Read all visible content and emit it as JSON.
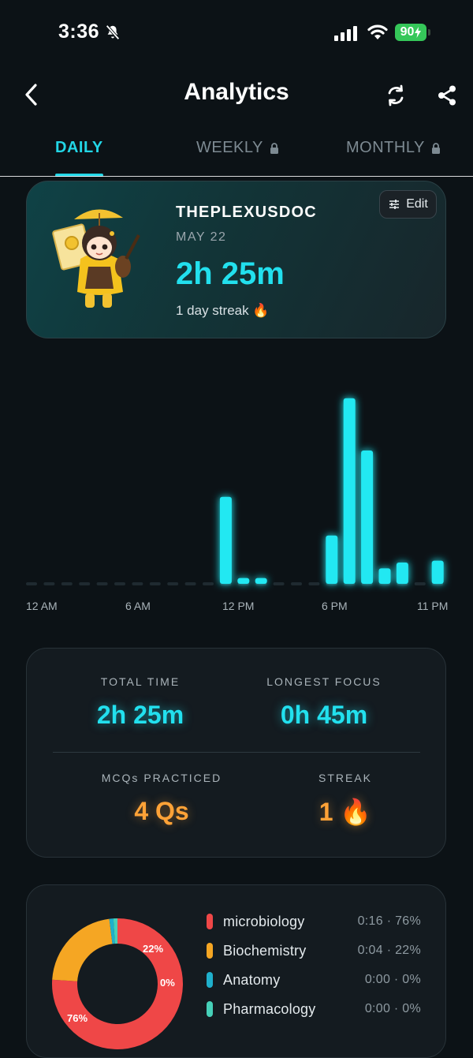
{
  "status_bar": {
    "time": "3:36",
    "battery": "90"
  },
  "header": {
    "title": "Analytics"
  },
  "tabs": [
    {
      "label": "DAILY",
      "active": true,
      "locked": false
    },
    {
      "label": "WEEKLY",
      "active": false,
      "locked": true
    },
    {
      "label": "MONTHLY",
      "active": false,
      "locked": true
    }
  ],
  "profile": {
    "name": "THEPLEXUSDOC",
    "date": "MAY 22",
    "total_time": "2h 25m",
    "streak_text": "1 day streak 🔥",
    "edit_label": "Edit"
  },
  "chart_data": {
    "type": "bar",
    "x_tick_labels": [
      "12 AM",
      "6 AM",
      "12 PM",
      "6 PM",
      "11 PM"
    ],
    "categories": [
      "0",
      "1",
      "2",
      "3",
      "4",
      "5",
      "6",
      "7",
      "8",
      "9",
      "10",
      "11",
      "12",
      "13",
      "14",
      "15",
      "16",
      "17",
      "18",
      "19",
      "20",
      "21",
      "22",
      "23"
    ],
    "values": [
      0,
      0,
      0,
      0,
      0,
      0,
      0,
      0,
      0,
      0,
      0,
      45,
      3,
      3,
      0,
      0,
      0,
      25,
      96,
      69,
      8,
      11,
      0,
      12
    ],
    "value_unit": "relative",
    "ylim": [
      0,
      100
    ],
    "colors": {
      "bar": "#22e8f2",
      "baseline": "#1f2a30"
    }
  },
  "stats": {
    "total_time_label": "TOTAL TIME",
    "total_time_value": "2h 25m",
    "longest_focus_label": "LONGEST FOCUS",
    "longest_focus_value": "0h 45m",
    "mcqs_label": "MCQs PRACTICED",
    "mcqs_value": "4 Qs",
    "streak_label": "STREAK",
    "streak_value": "1 🔥"
  },
  "subjects": [
    {
      "name": "microbiology",
      "value": "0:16 · 76%",
      "percent": 76,
      "slice_label": "76%",
      "color": "#ef4747"
    },
    {
      "name": "Biochemistry",
      "value": "0:04 · 22%",
      "percent": 22,
      "slice_label": "22%",
      "color": "#f5a623"
    },
    {
      "name": "Anatomy",
      "value": "0:00 · 0%",
      "percent": 1,
      "slice_label": "0%",
      "color": "#1fb0cc"
    },
    {
      "name": "Pharmacology",
      "value": "0:00 · 0%",
      "percent": 1,
      "slice_label": "",
      "color": "#46d0b8"
    }
  ]
}
